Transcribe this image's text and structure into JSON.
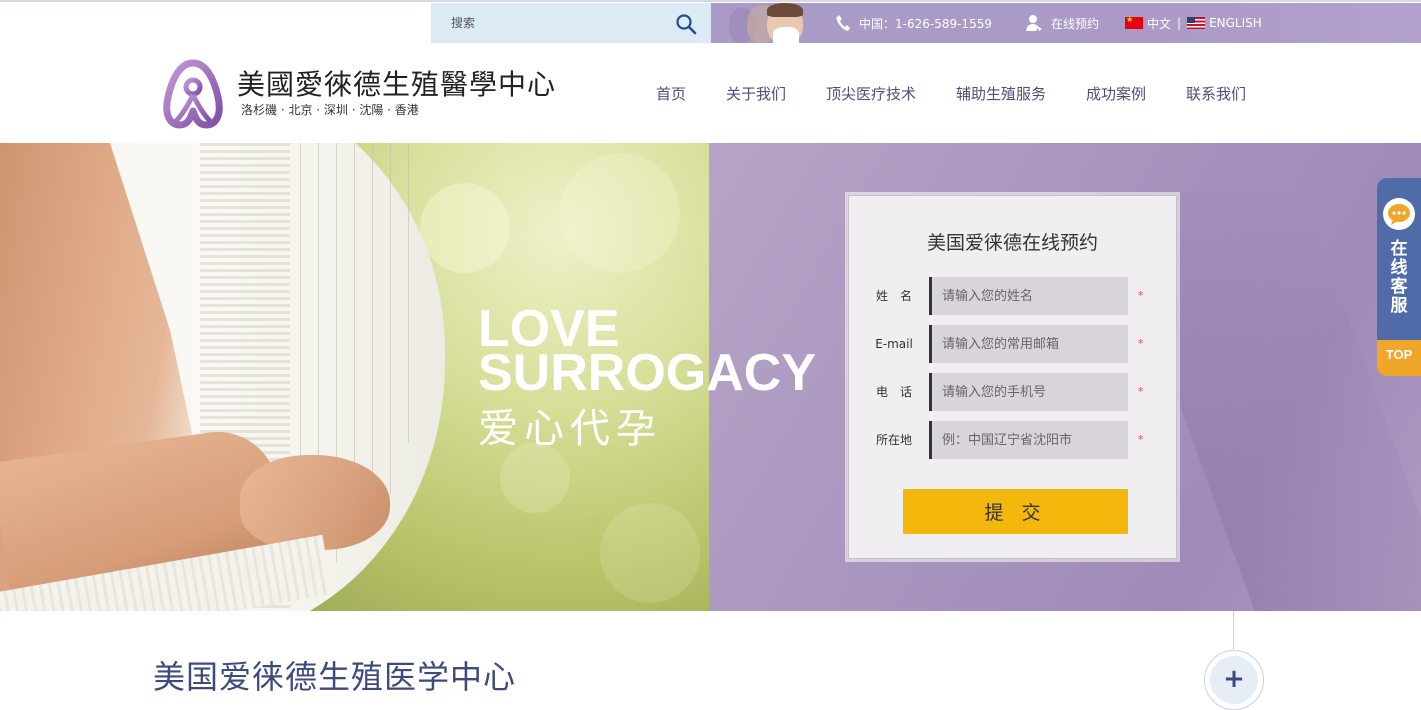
{
  "topbar": {
    "search_placeholder": "搜索",
    "phone": "中国：1-626-589-1559",
    "appointment": "在线预约",
    "lang_cn": "中文",
    "separator": "|",
    "lang_en": "ENGLISH"
  },
  "brand": {
    "title": "美國愛徠德生殖醫學中心",
    "subtitle": "洛杉磯 · 北京 · 深圳 · 沈陽 · 香港"
  },
  "nav": {
    "items": [
      {
        "label": "首页"
      },
      {
        "label": "关于我们"
      },
      {
        "label": "顶尖医疗技术"
      },
      {
        "label": "辅助生殖服务"
      },
      {
        "label": "成功案例"
      },
      {
        "label": "联系我们"
      }
    ]
  },
  "hero": {
    "line1": "LOVE",
    "line2": "SURROGACY",
    "line3": "爱心代孕"
  },
  "form": {
    "title": "美国爱徕德在线预约",
    "fields": [
      {
        "label": "姓　名",
        "placeholder": "请输入您的姓名",
        "required_mark": "*"
      },
      {
        "label": "E-mail",
        "placeholder": "请输入您的常用邮箱",
        "required_mark": "*"
      },
      {
        "label": "电　话",
        "placeholder": "请输入您的手机号",
        "required_mark": "*"
      },
      {
        "label": "所在地",
        "placeholder": "例：中国辽宁省沈阳市",
        "required_mark": "*"
      }
    ],
    "submit_label": "提 交"
  },
  "side_service": {
    "label": "在线客服",
    "top_label": "TOP"
  },
  "section": {
    "title": "美国爱徕德生殖医学中心",
    "plus_label": "+"
  },
  "colors": {
    "nav_text": "#4b4f7c",
    "submit_button": "#f4b80d",
    "side_service": "#4f6ca8",
    "top_button": "#f0a62b",
    "hero_right": "#a795be"
  }
}
